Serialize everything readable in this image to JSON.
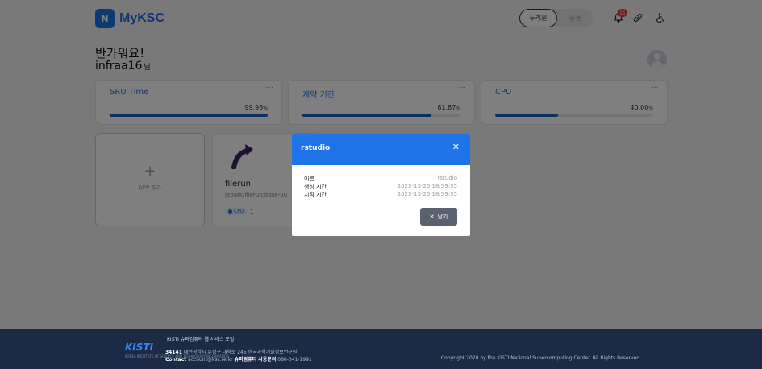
{
  "header": {
    "app_title": "MyKSC",
    "logo_mark": "N",
    "segments": [
      "누리온",
      "뉴론"
    ],
    "notification_count": "11",
    "icons": [
      "bell-icon",
      "link-icon",
      "accessibility-icon"
    ]
  },
  "greeting": {
    "line1": "반가워요!",
    "username": "infraa16",
    "suffix": "님"
  },
  "stats": [
    {
      "title": "SRU Time",
      "value": "99.95",
      "unit": "%",
      "percent": 99.95
    },
    {
      "title": "계약 기간",
      "value": "81.87",
      "unit": "%",
      "percent": 81.87
    },
    {
      "title": "CPU",
      "value": "40.00",
      "unit": "%",
      "percent": 40.0
    }
  ],
  "stat_more": "···",
  "apps": {
    "add_label": "APP 추가",
    "plus": "+",
    "items": [
      {
        "name": "filerun",
        "image": "jepark/filerun:base-00",
        "resource": "CPU",
        "count": "1"
      }
    ]
  },
  "modal": {
    "title": "rstudio",
    "close_glyph": "✕",
    "rows": [
      {
        "label": "이름",
        "value": "rstudio"
      },
      {
        "label": "생성 시간",
        "value": "2023-10-25 16:59:55"
      },
      {
        "label": "시작 시간",
        "value": "2023-10-25 16:59:55"
      }
    ],
    "close_label": "닫기"
  },
  "footer": {
    "logo": "KISTI",
    "logo_sub": "KOREA INSTITUTE OF SCIENCE AND TECHNOLOGY INFORMATION",
    "portal": "KISTI 슈퍼컴퓨터 웹 서비스 포털",
    "postcode": "34141",
    "address": "대전광역시 유성구 대학로 245 한국과학기술정보연구원",
    "contact_label": "Contact",
    "contact_email": "account@ksc.re.kr",
    "inquiry_label": "슈퍼컴퓨터 사용문의",
    "inquiry_phone": "080-041-1991",
    "copyright": "Copyright 2020 by the KISTI National Supercomputing Center. All Rights Reserved."
  },
  "colors": {
    "accent": "#1e73e8",
    "bar": "#1565c0",
    "footer": "#1b2a45",
    "badge": "#e53935"
  }
}
